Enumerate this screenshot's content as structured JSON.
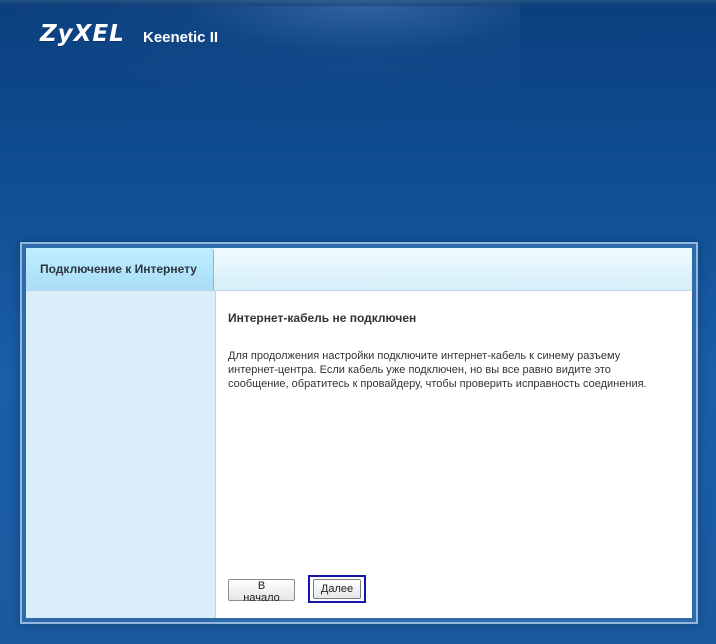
{
  "header": {
    "logo_text": "ZyXEL",
    "model_name": "Keenetic II"
  },
  "nav": {
    "tab_label": "Подключение к Интернету"
  },
  "content": {
    "title": "Интернет-кабель не подключен",
    "message": "Для продолжения настройки подключите интернет-кабель к синему разъему интернет-центра. Если кабель уже подключен, но вы все равно видите это сообщение, обратитесь к провайдеру, чтобы проверить исправность соединения."
  },
  "buttons": {
    "home_label": "В начало",
    "next_label": "Далее"
  },
  "colors": {
    "background_blue": "#1a5aa0",
    "panel_light_blue": "#d9eef9",
    "focus_blue": "#1515a8"
  }
}
